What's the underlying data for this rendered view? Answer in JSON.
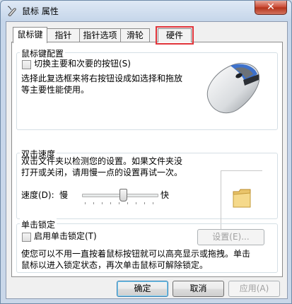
{
  "window": {
    "title": "鼠标 属性",
    "close_glyph": "✕"
  },
  "tabs": [
    {
      "label": "鼠标键",
      "active": true
    },
    {
      "label": "指针"
    },
    {
      "label": "指针选项"
    },
    {
      "label": "滑轮"
    },
    {
      "label": "硬件",
      "highlighted": true
    }
  ],
  "button_config": {
    "title": "鼠标键配置",
    "switch_label": "切换主要和次要的按钮(S)",
    "switch_checked": false,
    "description": "选择此复选框来将右按钮设成如选择和拖放等主要性能使用。",
    "description_lines": [
      "选择此复选框来将右按钮设成如选择和拖放",
      "等主要性能使用。"
    ]
  },
  "double_click": {
    "title": "双击速度",
    "description_lines": [
      "双击文件夹以检测您的设置。如果文件夹没",
      "打开或关闭，请用慢一点的设置再试一次。"
    ],
    "speed_label": "速度(D):",
    "slow_label": "慢",
    "fast_label": "快",
    "speed_fraction": 0.55
  },
  "click_lock": {
    "title": "单击锁定",
    "enable_label": "启用单击锁定(T)",
    "enable_checked": false,
    "settings_button": "设置(E)...",
    "description_lines": [
      "使您可以不用一直按着鼠标按钮就可以高亮显示或拖拽。单击",
      "鼠标以进入锁定状态，再次单击鼠标可解除锁定。"
    ]
  },
  "footer": {
    "ok": "确定",
    "cancel": "取消",
    "apply": "应用(A)"
  },
  "colors": {
    "highlight_outline": "#e0343a",
    "window_frame": "#c6d6ea"
  }
}
